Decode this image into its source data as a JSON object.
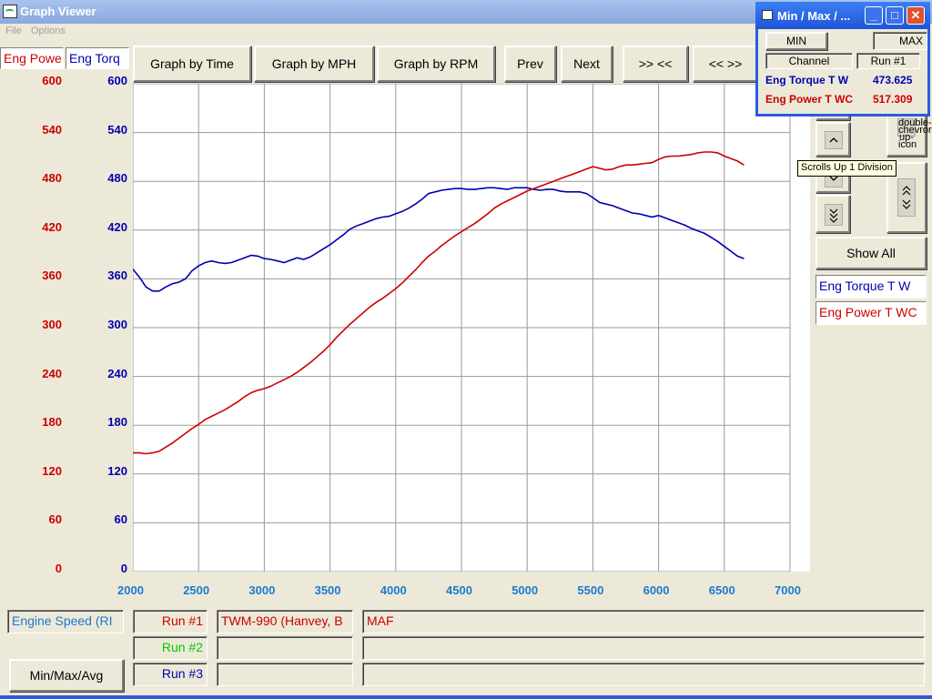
{
  "window": {
    "title": "Graph Viewer"
  },
  "menu": {
    "file": "File",
    "options": "Options"
  },
  "channels": {
    "power_label": "Eng Powe",
    "torque_label": "Eng Torq",
    "power_color": "#cc0000",
    "torque_color": "#0000b0"
  },
  "toolbar": {
    "graph_by_time": "Graph by Time",
    "graph_by_mph": "Graph by MPH",
    "graph_by_rpm": "Graph by RPM",
    "prev": "Prev",
    "next": "Next",
    "zoom_in": ">> <<",
    "zoom_out": "<< >>"
  },
  "right_panel": {
    "scroll_up_icon": "chevron-up-icon",
    "scroll_down_icon": "chevron-down-icon",
    "double_down_icon": "double-chevron-down-icon",
    "page_up_icon": "double-chevron-up-icon",
    "expand_icon": "expand-vertical-icon",
    "show_all": "Show All",
    "legend_torque": "Eng Torque T W",
    "legend_power": "Eng Power T WC"
  },
  "tooltip": "Scrolls Up 1 Division",
  "minmax_window": {
    "title": "Min / Max / ...",
    "min_label": "MIN",
    "max_label": "MAX",
    "channel_header": "Channel",
    "run_header": "Run #1",
    "rows": [
      {
        "channel": "Eng Torque T W",
        "value": "473.625"
      },
      {
        "channel": "Eng Power T WC",
        "value": "517.309"
      }
    ]
  },
  "bottom": {
    "x_channel": "Engine Speed (RI",
    "runs": [
      {
        "label": "Run #1",
        "color": "#cc0000",
        "file": "TWM-990 (Hanvey, B",
        "note": "MAF"
      },
      {
        "label": "Run #2",
        "color": "#00cc00",
        "file": "",
        "note": ""
      },
      {
        "label": "Run #3",
        "color": "#0000b0",
        "file": "",
        "note": ""
      }
    ],
    "minmax_button": "Min/Max/Avg"
  },
  "chart_data": {
    "type": "line",
    "xlim": [
      2000,
      7000
    ],
    "x_ticks": [
      "2000",
      "2500",
      "3000",
      "3500",
      "4000",
      "4500",
      "5000",
      "5500",
      "6000",
      "6500",
      "7000"
    ],
    "y_left_ticks": [
      "600",
      "540",
      "480",
      "420",
      "360",
      "300",
      "240",
      "180",
      "120",
      "60",
      "0"
    ],
    "y_right_ticks": [
      "600",
      "540",
      "480",
      "420",
      "360",
      "300",
      "240",
      "180",
      "120",
      "60",
      "0"
    ],
    "ylim": [
      0,
      600
    ],
    "grid": true,
    "series": [
      {
        "name": "Eng Torque T W",
        "color": "#0000b0",
        "x": [
          2000,
          2050,
          2100,
          2150,
          2200,
          2250,
          2300,
          2350,
          2400,
          2450,
          2500,
          2550,
          2600,
          2650,
          2700,
          2750,
          2800,
          2850,
          2900,
          2950,
          3000,
          3050,
          3100,
          3150,
          3200,
          3250,
          3300,
          3350,
          3400,
          3450,
          3500,
          3550,
          3600,
          3650,
          3700,
          3750,
          3800,
          3850,
          3900,
          3950,
          4000,
          4050,
          4100,
          4150,
          4200,
          4250,
          4300,
          4350,
          4400,
          4450,
          4500,
          4550,
          4600,
          4650,
          4700,
          4750,
          4800,
          4850,
          4900,
          4950,
          5000,
          5050,
          5100,
          5150,
          5200,
          5250,
          5300,
          5350,
          5400,
          5450,
          5500,
          5550,
          5600,
          5650,
          5700,
          5750,
          5800,
          5850,
          5900,
          5950,
          6000,
          6050,
          6100,
          6150,
          6200,
          6250,
          6300,
          6350,
          6400,
          6450,
          6500,
          6550,
          6600,
          6650
        ],
        "y": [
          372,
          362,
          350,
          345,
          345,
          350,
          354,
          356,
          360,
          370,
          376,
          380,
          382,
          380,
          379,
          380,
          383,
          386,
          389,
          388,
          385,
          384,
          382,
          380,
          383,
          386,
          384,
          387,
          392,
          397,
          402,
          408,
          414,
          421,
          425,
          428,
          431,
          434,
          436,
          437,
          440,
          443,
          447,
          452,
          458,
          465,
          467,
          469,
          470,
          471,
          471,
          470,
          470,
          471,
          472,
          472,
          471,
          470,
          472,
          472,
          472,
          470,
          469,
          470,
          470,
          468,
          467,
          467,
          467,
          465,
          460,
          454,
          452,
          450,
          447,
          444,
          441,
          440,
          438,
          436,
          438,
          435,
          432,
          429,
          426,
          422,
          419,
          416,
          411,
          406,
          400,
          394,
          388,
          385
        ]
      },
      {
        "name": "Eng Power T WC",
        "color": "#cc0000",
        "x": [
          2000,
          2050,
          2100,
          2150,
          2200,
          2250,
          2300,
          2350,
          2400,
          2450,
          2500,
          2550,
          2600,
          2650,
          2700,
          2750,
          2800,
          2850,
          2900,
          2950,
          3000,
          3050,
          3100,
          3150,
          3200,
          3250,
          3300,
          3350,
          3400,
          3450,
          3500,
          3550,
          3600,
          3650,
          3700,
          3750,
          3800,
          3850,
          3900,
          3950,
          4000,
          4050,
          4100,
          4150,
          4200,
          4250,
          4300,
          4350,
          4400,
          4450,
          4500,
          4550,
          4600,
          4650,
          4700,
          4750,
          4800,
          4850,
          4900,
          4950,
          5000,
          5050,
          5100,
          5150,
          5200,
          5250,
          5300,
          5350,
          5400,
          5450,
          5500,
          5550,
          5600,
          5650,
          5700,
          5750,
          5800,
          5850,
          5900,
          5950,
          6000,
          6050,
          6100,
          6150,
          6200,
          6250,
          6300,
          6350,
          6400,
          6450,
          6500,
          6550,
          6600,
          6650
        ],
        "y": [
          146,
          146,
          145,
          146,
          148,
          153,
          158,
          164,
          170,
          176,
          181,
          187,
          191,
          195,
          199,
          204,
          209,
          215,
          220,
          223,
          225,
          228,
          232,
          236,
          240,
          245,
          251,
          257,
          264,
          271,
          279,
          288,
          296,
          304,
          311,
          318,
          325,
          331,
          336,
          342,
          348,
          355,
          363,
          371,
          380,
          388,
          394,
          401,
          407,
          413,
          418,
          423,
          428,
          434,
          440,
          447,
          452,
          456,
          460,
          464,
          468,
          471,
          474,
          477,
          480,
          483,
          486,
          489,
          492,
          495,
          498,
          496,
          494,
          495,
          498,
          500,
          500,
          501,
          502,
          503,
          507,
          510,
          511,
          511,
          512,
          513,
          515,
          516,
          516,
          515,
          511,
          508,
          505,
          500
        ]
      }
    ]
  }
}
